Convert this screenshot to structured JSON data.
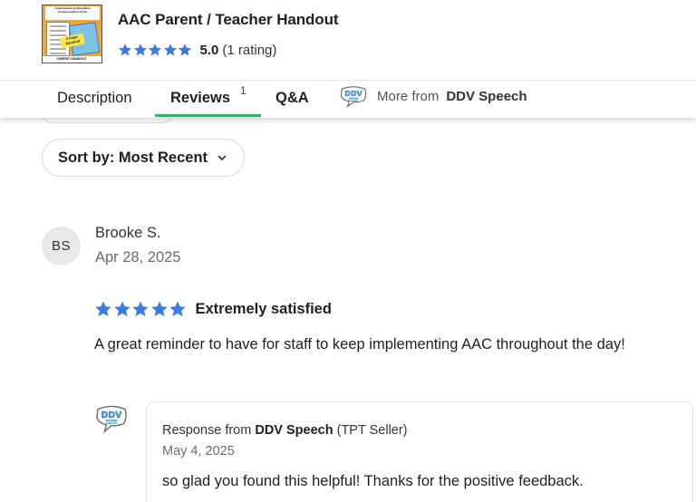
{
  "product": {
    "title": "AAC Parent / Teacher Handout",
    "thumbnail_title": "Augmentative & Alternative Communication (AAC)",
    "thumbnail_badge": "2 Page Handout",
    "thumbnail_footer": "PARENT HANDOUT",
    "rating_value": "5.0",
    "rating_count": "(1 rating)",
    "stars": 5
  },
  "tabs": {
    "description": "Description",
    "reviews": "Reviews",
    "reviews_count": "1",
    "qa": "Q&A",
    "more_from": "More from",
    "seller_name": "DDV Speech",
    "logo_text": "DDV",
    "logo_subtext": "SPEECH"
  },
  "sort": {
    "label": "Sort by: Most Recent"
  },
  "review": {
    "avatar_initials": "BS",
    "reviewer": "Brooke S.",
    "date": "Apr 28, 2025",
    "stars": 5,
    "headline": "Extremely satisfied",
    "body": "A great reminder to have for staff to keep implementing AAC throughout the day!"
  },
  "response": {
    "prefix": "Response from",
    "seller": "DDV Speech",
    "suffix": "(TPT Seller)",
    "date": "May 4, 2025",
    "body": "so glad you found this helpful! Thanks for the positive feedback."
  },
  "colors": {
    "star": "#3b7ddd",
    "tab_underline": "#2fb36d",
    "thumbnail_bg": "#f2a531"
  }
}
